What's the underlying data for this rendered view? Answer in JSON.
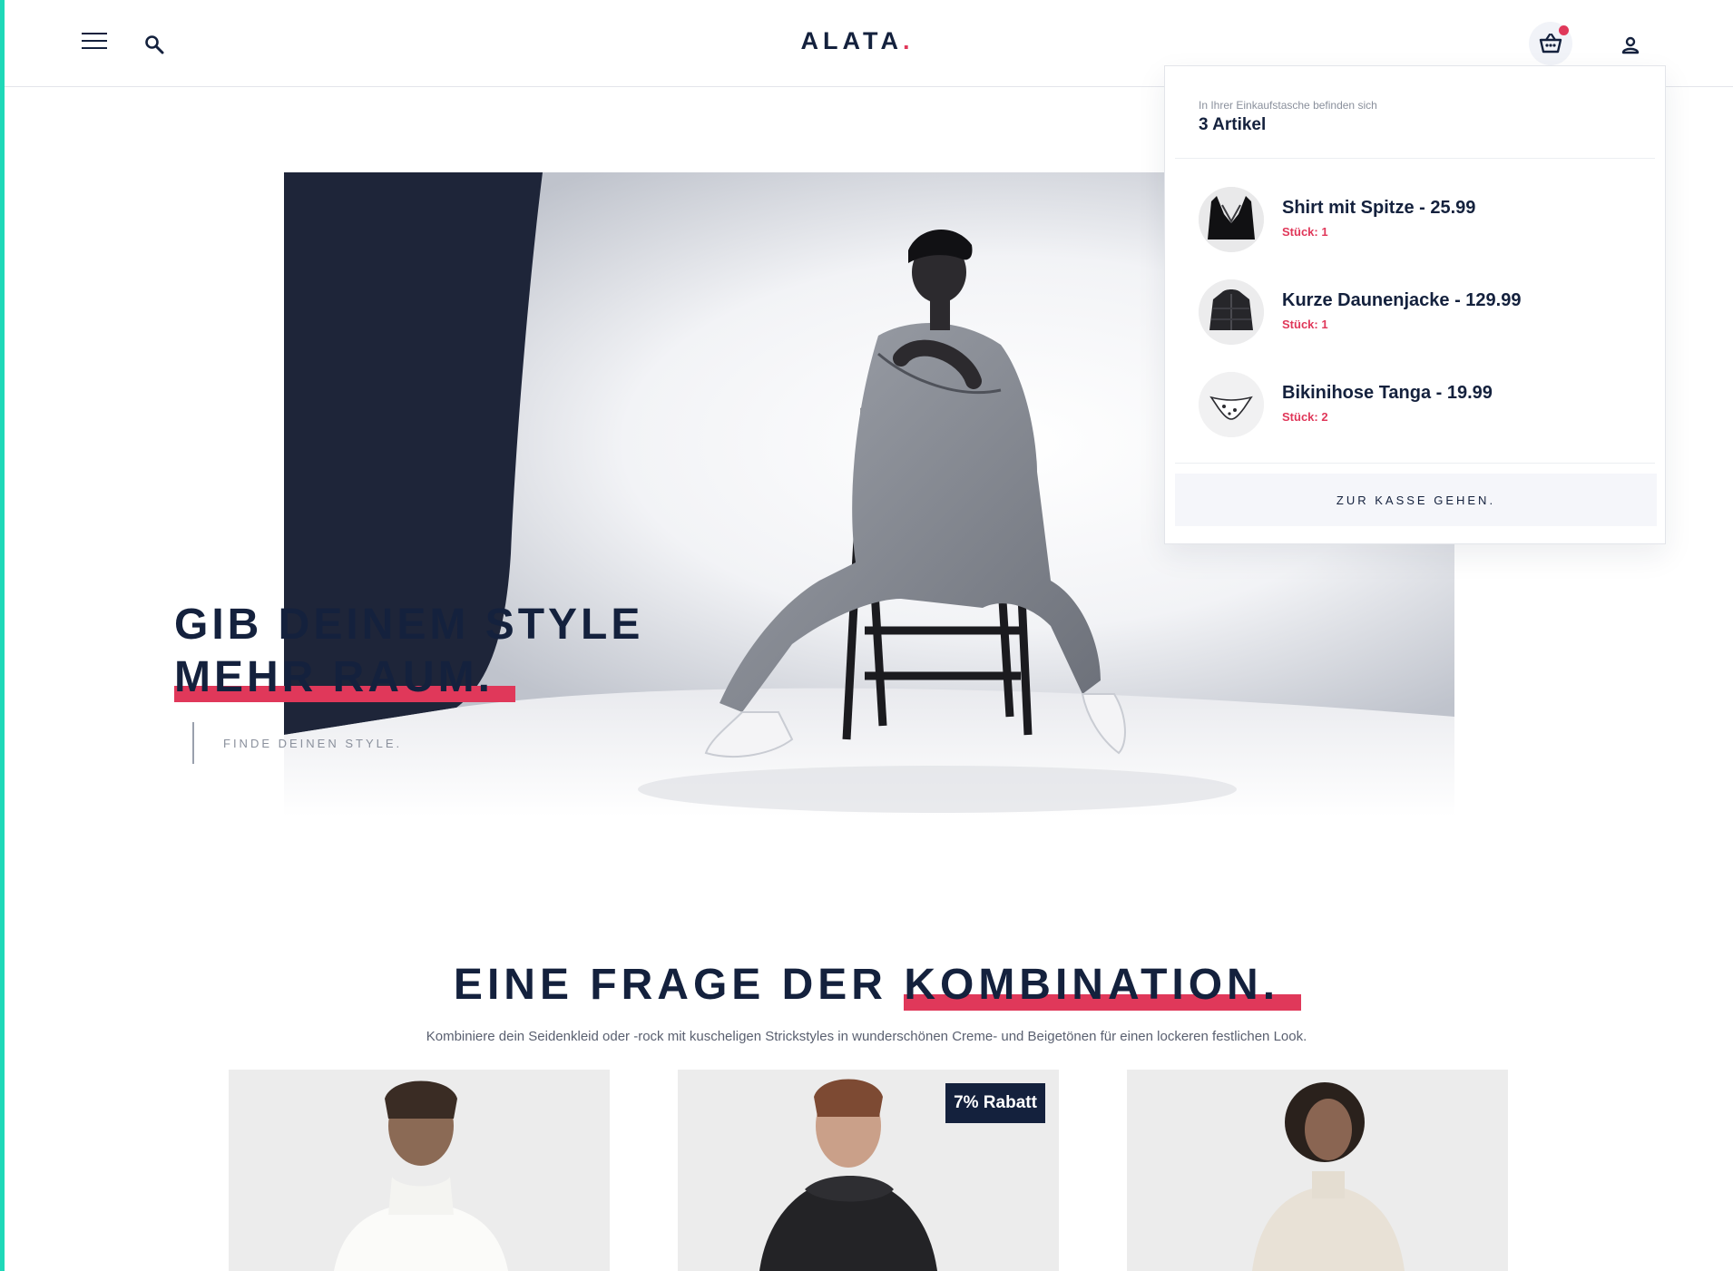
{
  "brand": {
    "name": "ALATA",
    "dot": "."
  },
  "colors": {
    "navy": "#14213d",
    "accent": "#e0385a",
    "edge": "#1fd8b8",
    "muted": "#8a909c"
  },
  "header": {
    "icons": [
      "menu-icon",
      "search-icon",
      "basket-icon",
      "user-icon"
    ],
    "basket_has_items": true
  },
  "hero": {
    "headline_line1": "GIB DEINEM STYLE",
    "headline_line2": "MEHR RAUM.",
    "cta": "FINDE DEINEN STYLE."
  },
  "cart": {
    "caption": "In Ihrer Einkaufstasche befinden sich",
    "count": "3 Artikel",
    "items": [
      {
        "name": "Shirt mit Spitze - 25.99",
        "qty": "Stück: 1",
        "icon": "lace-top-icon"
      },
      {
        "name": "Kurze Daunenjacke - 129.99",
        "qty": "Stück: 1",
        "icon": "down-jacket-icon"
      },
      {
        "name": "Bikinihose Tanga - 19.99",
        "qty": "Stück: 2",
        "icon": "bikini-bottom-icon"
      }
    ],
    "checkout": "ZUR KASSE GEHEN."
  },
  "section": {
    "title_plain": "EINE FRAGE DER",
    "title_highlight": "KOMBINATION.",
    "subtitle": "Kombiniere dein Seidenkleid oder -rock mit kuscheligen Strickstyles in wunderschönen Creme- und Beigetönen für einen lockeren festlichen Look."
  },
  "products": [
    {
      "badge": ""
    },
    {
      "badge": "7% Rabatt"
    },
    {
      "badge": ""
    }
  ]
}
